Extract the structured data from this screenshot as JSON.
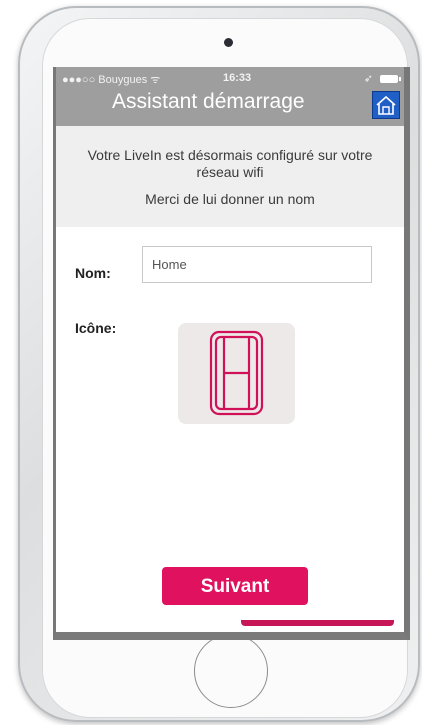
{
  "status_bar": {
    "carrier": "●●●○○ Bouygues ᯤ",
    "time": "16:33",
    "location_arrow": "➶"
  },
  "header": {
    "title": "Assistant démarrage",
    "home_icon": "home-icon"
  },
  "info": {
    "line1": "Votre LiveIn est désormais configuré sur votre réseau wifi",
    "line2": "Merci de lui donner un nom"
  },
  "form": {
    "name_label": "Nom:",
    "name_value": "Home",
    "icon_label": "Icône:",
    "selected_icon": "door-icon"
  },
  "actions": {
    "next_label": "Suivant"
  },
  "colors": {
    "accent": "#e0115f",
    "header_bg": "#9e9e9e",
    "info_bg": "#efefef",
    "home_icon_bg": "#1f5fc6"
  }
}
